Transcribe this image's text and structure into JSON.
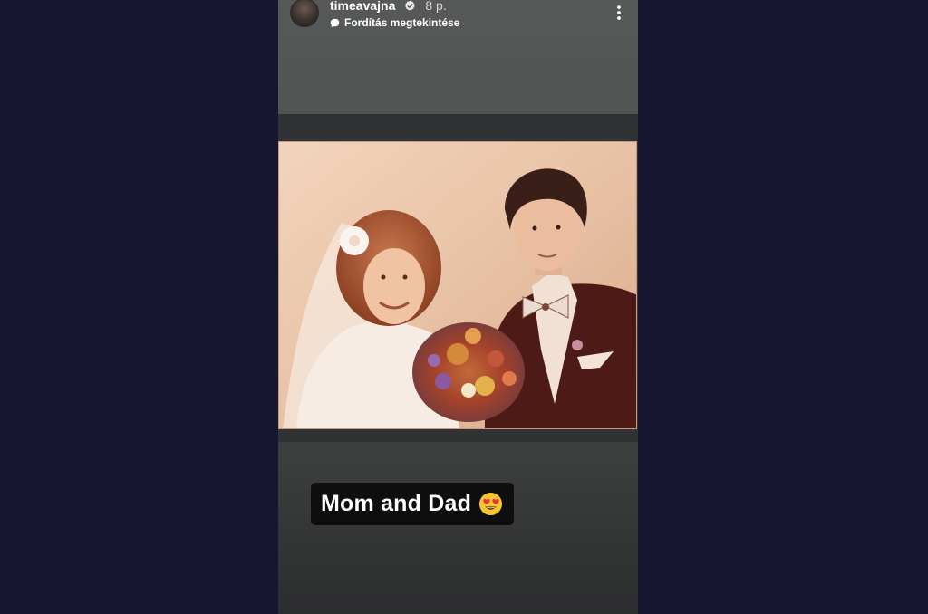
{
  "story": {
    "username": "timeavajna",
    "time_ago": "8 p.",
    "translate_label": "Fordítás megtekintése",
    "caption": "Mom and Dad",
    "caption_emoji": "heart-eyes-emoji-icon"
  },
  "colors": {
    "page_background": "#161631",
    "story_background": "#575959",
    "sticker_background": "#0e0e0e",
    "text": "#ffffff"
  },
  "icons": {
    "verified": "verified-badge-icon",
    "translate": "speech-bubble-icon",
    "more": "more-options-icon"
  },
  "photo": {
    "subject": "vintage sepia wedding photo",
    "dominant_colors": [
      "#e8c6a8",
      "#4a1e1a",
      "#f3e4d8"
    ]
  }
}
